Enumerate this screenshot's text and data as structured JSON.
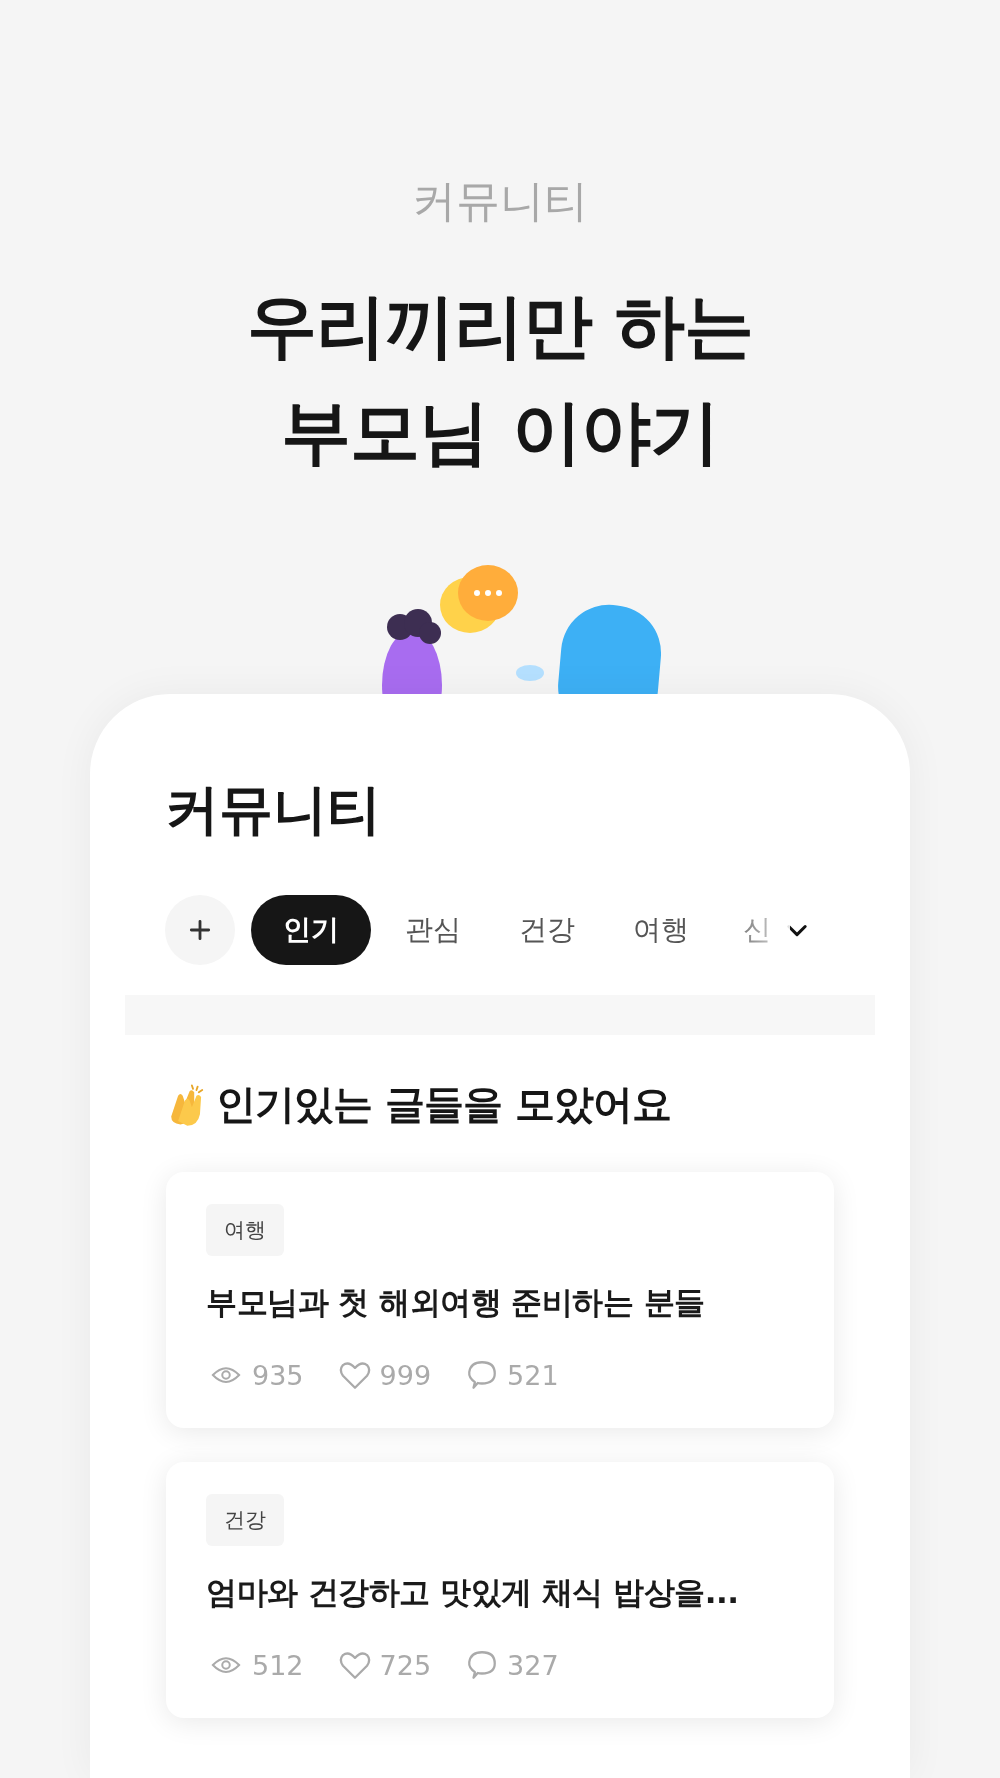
{
  "header": {
    "eyebrow": "커뮤니티",
    "headline_lines": [
      "우리끼리만 하는",
      "부모님 이야기"
    ]
  },
  "screen": {
    "title": "커뮤니티",
    "tabs": [
      {
        "label": "인기",
        "selected": true
      },
      {
        "label": "관심",
        "selected": false
      },
      {
        "label": "건강",
        "selected": false
      },
      {
        "label": "여행",
        "selected": false
      },
      {
        "label": "신",
        "selected": false
      }
    ],
    "section_title": "인기있는 글들을 모았어요",
    "posts": [
      {
        "tag": "여행",
        "title": "부모님과 첫 해외여행 준비하는 분들",
        "views": "935",
        "likes": "999",
        "comments": "521"
      },
      {
        "tag": "건강",
        "title": "엄마와 건강하고 맛있게 채식 밥상을...",
        "views": "512",
        "likes": "725",
        "comments": "327"
      }
    ]
  }
}
